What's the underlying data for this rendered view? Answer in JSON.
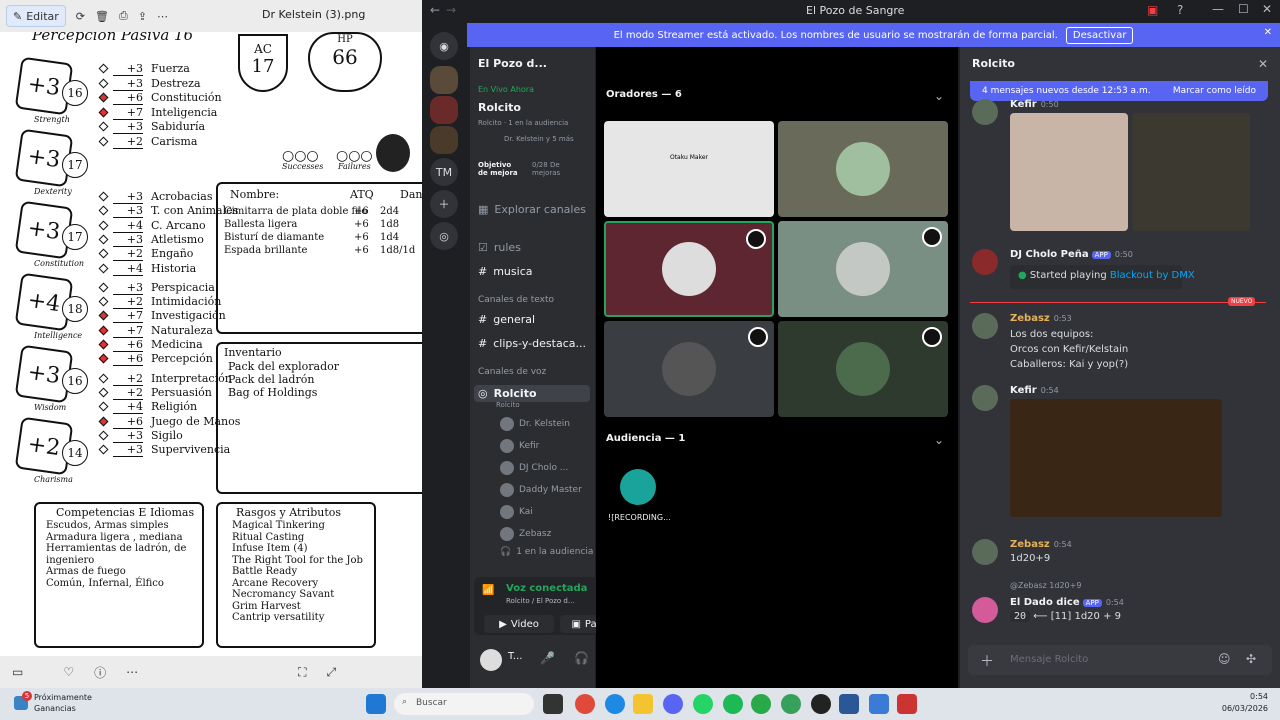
{
  "viewer": {
    "edit_label": "Editar",
    "filename": "Dr Kelstein (3).png",
    "sheet": {
      "header_title": "Percepción Pasiva 16",
      "ac_label": "AC",
      "ac_value": "17",
      "hp_label": "HP",
      "hp_value": "66",
      "successes": "Successes",
      "failures": "Failures",
      "stats": [
        {
          "mod": "+3",
          "score": "16",
          "name": "Strength"
        },
        {
          "mod": "+3",
          "score": "17",
          "name": "Dexterity"
        },
        {
          "mod": "+3",
          "score": "17",
          "name": "Constitution"
        },
        {
          "mod": "+4",
          "score": "18",
          "name": "Intelligence"
        },
        {
          "mod": "+3",
          "score": "16",
          "name": "Wisdom"
        },
        {
          "mod": "+2",
          "score": "14",
          "name": "Charisma"
        }
      ],
      "saves": [
        {
          "v": "+3",
          "n": "Fuerza",
          "on": false
        },
        {
          "v": "+3",
          "n": "Destreza",
          "on": false
        },
        {
          "v": "+6",
          "n": "Constitución",
          "on": true
        },
        {
          "v": "+7",
          "n": "Inteligencia",
          "on": true
        },
        {
          "v": "+3",
          "n": "Sabiduría",
          "on": false
        },
        {
          "v": "+2",
          "n": "Carisma",
          "on": false
        }
      ],
      "skills": [
        {
          "v": "+3",
          "n": "Acrobacias",
          "on": false
        },
        {
          "v": "+3",
          "n": "T. con Animales",
          "on": false
        },
        {
          "v": "+4",
          "n": "C. Arcano",
          "on": false
        },
        {
          "v": "+3",
          "n": "Atletismo",
          "on": false
        },
        {
          "v": "+2",
          "n": "Engaño",
          "on": false
        },
        {
          "v": "+4",
          "n": "Historia",
          "on": false
        },
        {
          "v": "+3",
          "n": "Perspicacia",
          "on": false
        },
        {
          "v": "+2",
          "n": "Intimidación",
          "on": false
        },
        {
          "v": "+7",
          "n": "Investigación",
          "on": true
        },
        {
          "v": "+7",
          "n": "Naturaleza",
          "on": true
        },
        {
          "v": "+6",
          "n": "Medicina",
          "on": true
        },
        {
          "v": "+6",
          "n": "Percepción",
          "on": true
        },
        {
          "v": "+2",
          "n": "Interpretación",
          "on": false
        },
        {
          "v": "+2",
          "n": "Persuasión",
          "on": false
        },
        {
          "v": "+4",
          "n": "Religión",
          "on": false
        },
        {
          "v": "+6",
          "n": "Juego de Manos",
          "on": true
        },
        {
          "v": "+3",
          "n": "Sigilo",
          "on": false
        },
        {
          "v": "+3",
          "n": "Supervivencia",
          "on": false
        }
      ],
      "weapons_header": {
        "name": "Nombre:",
        "atk": "ATQ",
        "dmg": "Dan"
      },
      "weapons": [
        {
          "name": "Cimitarra de plata doble filo",
          "atk": "+6",
          "dmg": "2d4"
        },
        {
          "name": "Ballesta ligera",
          "atk": "+6",
          "dmg": "1d8"
        },
        {
          "name": "Bisturí de diamante",
          "atk": "+6",
          "dmg": "1d4"
        },
        {
          "name": "Espada brillante",
          "atk": "+6",
          "dmg": "1d8/1d"
        }
      ],
      "inventory_title": "Inventario",
      "inventory": [
        "Pack del explorador",
        "Pack del ladrón",
        "Bag of Holdings"
      ],
      "prof_title": "Competencias E Idiomas",
      "prof": [
        "Escudos, Armas simples",
        "Armadura ligera , mediana",
        "Herramientas de ladrón, de",
        "ingeniero",
        "Armas de fuego",
        "Común, Infernal, Élfico"
      ],
      "traits_title": "Rasgos y Atributos",
      "traits": [
        "Magical Tinkering",
        "Ritual Casting",
        "Infuse Item (4)",
        "The Right Tool for the Job",
        "Battle Ready",
        "Arcane Recovery",
        "Necromancy Savant",
        "Grim Harvest",
        "Cantrip versatility"
      ]
    }
  },
  "discord": {
    "window_title": "El Pozo de Sangre",
    "banner_text": "El modo Streamer está activado. Los nombres de usuario se mostrarán de forma parcial.",
    "banner_button": "Desactivar",
    "server_name": "El Pozo d...",
    "live_label": "En Vivo Ahora",
    "live_channel": "Rolcito",
    "live_sub": "Rolcito · 1 en la audiencia",
    "live_users": "Dr. Kelstein y 5 más",
    "goal_label": "Objetivo de mejora",
    "goal_value": "0/28 De mejoras",
    "explore": "Explorar canales",
    "rules": "rules",
    "musica": "musica",
    "text_category": "Canales de texto",
    "general": "general",
    "clips": "clips-y-destaca...",
    "voice_category": "Canales de voz",
    "voice_channel": "Rolcito",
    "voice_channel_sub": "Rolcito",
    "voice_users": [
      "Dr. Kelstein",
      "Kefir",
      "DJ Cholo ...",
      "Daddy Master",
      "Kai",
      "Zebasz"
    ],
    "audience_count": "1 en la audiencia",
    "voice_connected": "Voz conectada",
    "voice_connected_sub": "Rolcito / El Pozo d...",
    "video_btn": "Video",
    "screen_btn": "Pantall",
    "me_name": "T...",
    "stage_speakers": "Oradores — 6",
    "stage_audience": "Audiencia — 1",
    "audience_member": "![RECORDING...",
    "otaku_text": "Otaku Maker",
    "chat_title": "Rolcito",
    "new_msgs": "4 mensajes nuevos desde 12:53 a.m.",
    "mark_read": "Marcar como leído",
    "new_badge": "NUEVO",
    "messages": {
      "kefir1": {
        "user": "Kefir",
        "time": "0:50"
      },
      "dj": {
        "user": "DJ Cholo Peña",
        "tag": "APP",
        "time": "0:50",
        "playing": "Started playing",
        "song": "Blackout by DMX"
      },
      "zebasz1": {
        "user": "Zebasz",
        "time": "0:53",
        "lines": [
          "Los dos equipos:",
          "Orcos con Kefir/Kelstain",
          "Caballeros: Kai y yop(?)"
        ]
      },
      "kefir2": {
        "user": "Kefir",
        "time": "0:54"
      },
      "zebasz2": {
        "user": "Zebasz",
        "time": "0:54",
        "text": "1d20+9"
      },
      "dice": {
        "reply": "@Zebasz 1d20+9",
        "user": "El Dado dice",
        "tag": "APP",
        "time": "0:54",
        "result": "20",
        "text": "⟵ [11] 1d20 + 9"
      }
    },
    "chat_placeholder": "Mensaje Rolcito"
  },
  "taskbar": {
    "weather_line1": "Próximamente",
    "weather_line2": "Ganancias",
    "search_placeholder": "Buscar",
    "time": "0:54",
    "date": "06/03/2026",
    "badge": "5"
  },
  "colors": {
    "blurple": "#5865f2",
    "green": "#23a55a",
    "red": "#f23f43"
  }
}
